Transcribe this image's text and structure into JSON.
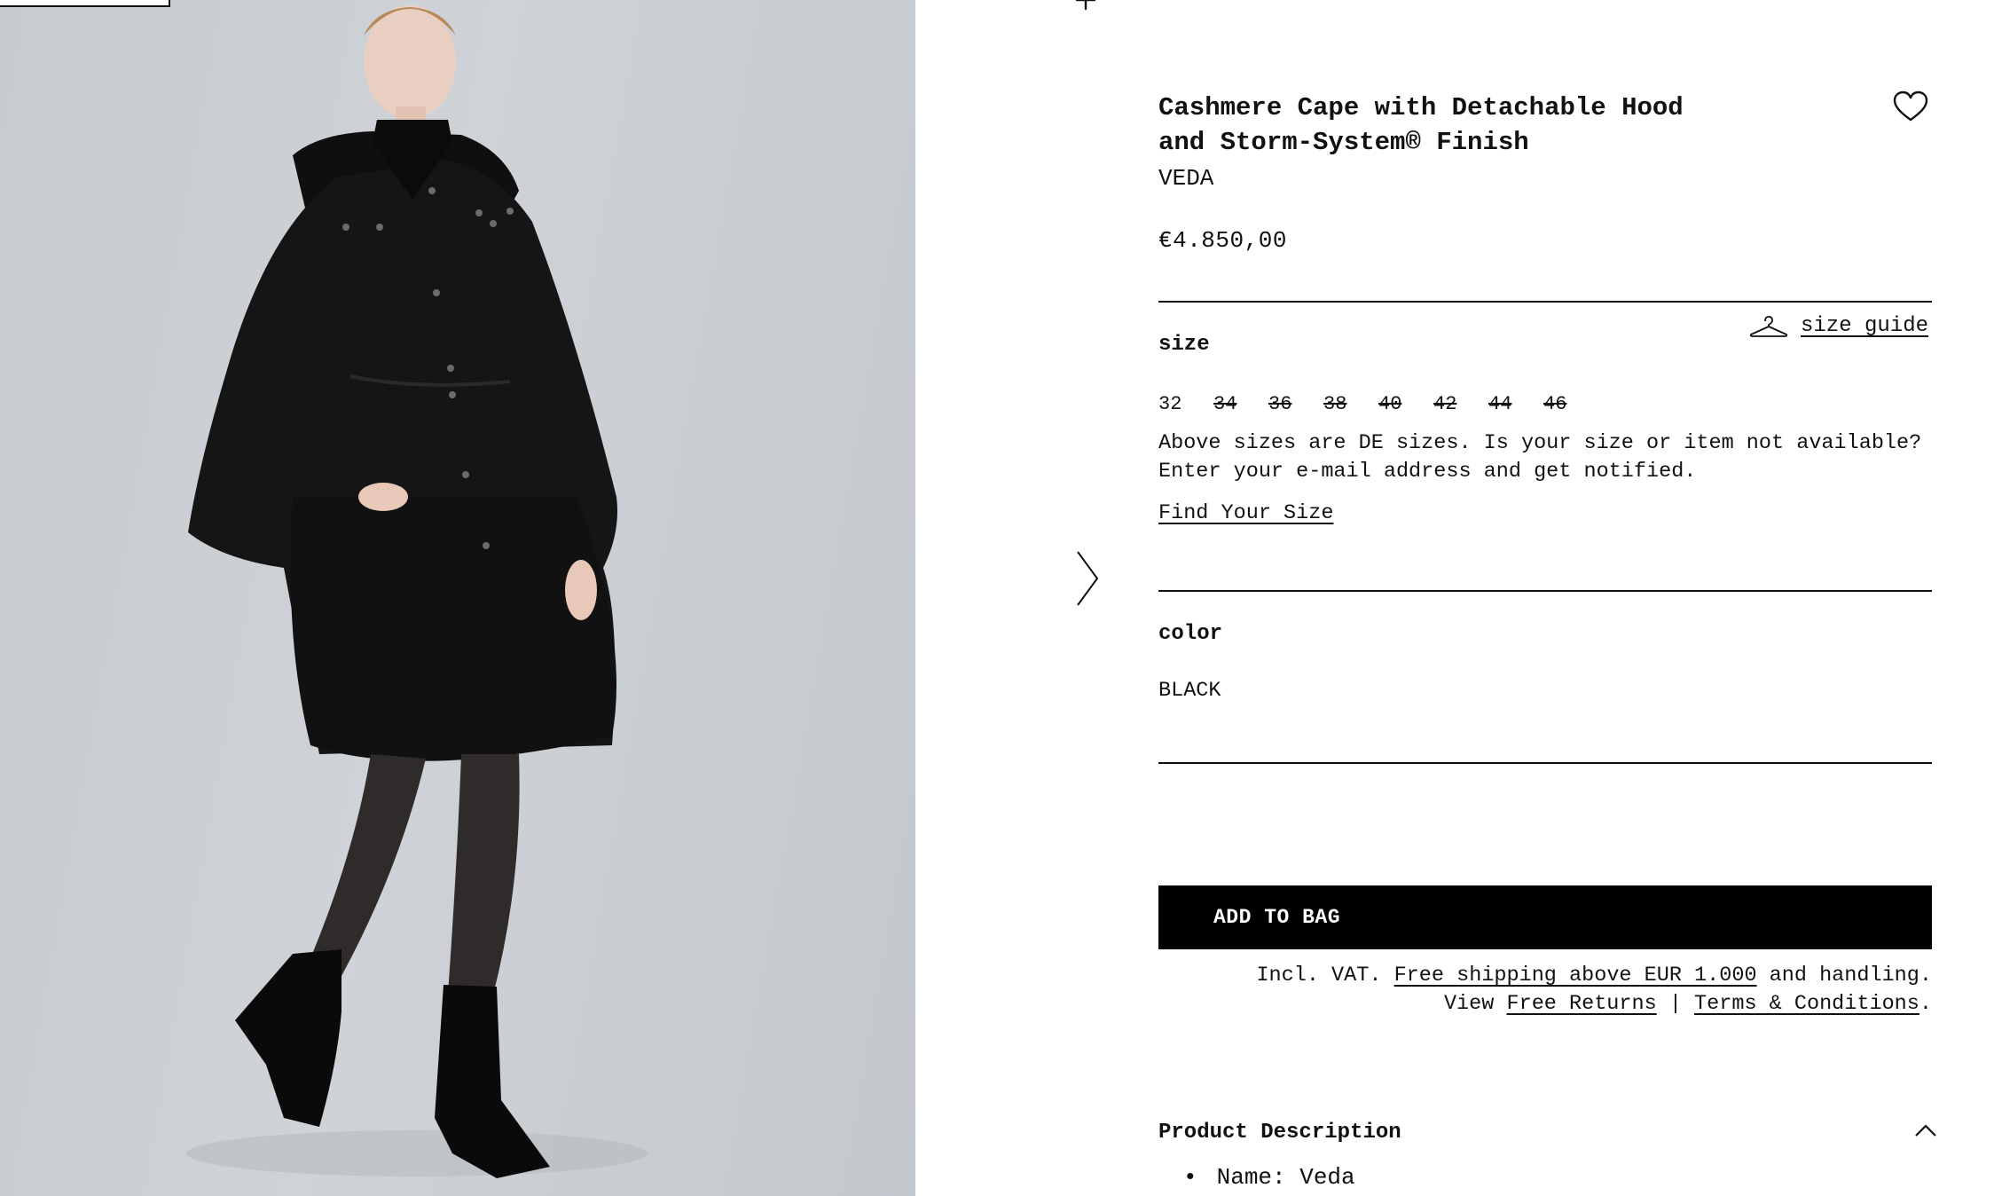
{
  "product": {
    "title": "Cashmere Cape with Detachable Hood and Storm-System® Finish",
    "brand": "VEDA",
    "price": "€4.850,00"
  },
  "size_section": {
    "label": "size",
    "guide_label": "size guide",
    "options": [
      {
        "label": "32",
        "available": true
      },
      {
        "label": "34",
        "available": false
      },
      {
        "label": "36",
        "available": false
      },
      {
        "label": "38",
        "available": false
      },
      {
        "label": "40",
        "available": false
      },
      {
        "label": "42",
        "available": false
      },
      {
        "label": "44",
        "available": false
      },
      {
        "label": "46",
        "available": false
      }
    ],
    "note": "Above sizes are DE sizes. Is your size or item not available? Enter your e-mail address and get notified.",
    "find_size_link": "Find Your Size"
  },
  "color_section": {
    "label": "color",
    "value": "BLACK"
  },
  "cart": {
    "add_to_bag": "ADD TO BAG"
  },
  "shipping": {
    "vat_prefix": "Incl. VAT.",
    "free_shipping_link": "Free shipping above EUR 1.000",
    "vat_suffix": "and handling.",
    "view_prefix": "View",
    "returns_link": "Free Returns",
    "separator": "|",
    "terms_link": "Terms & Conditions",
    "terms_suffix": "."
  },
  "description": {
    "header": "Product Description",
    "items": [
      {
        "bullet": "•",
        "text": "Name: Veda"
      }
    ]
  },
  "colors": {
    "photo_background": "#cbd0d4",
    "garment": "#141414",
    "button_bg": "#000000",
    "button_text": "#ffffff"
  },
  "icons": {
    "wishlist": "heart-icon",
    "size_guide": "hanger-icon",
    "next": "chevron-right-icon",
    "collapse": "chevron-up-icon"
  }
}
